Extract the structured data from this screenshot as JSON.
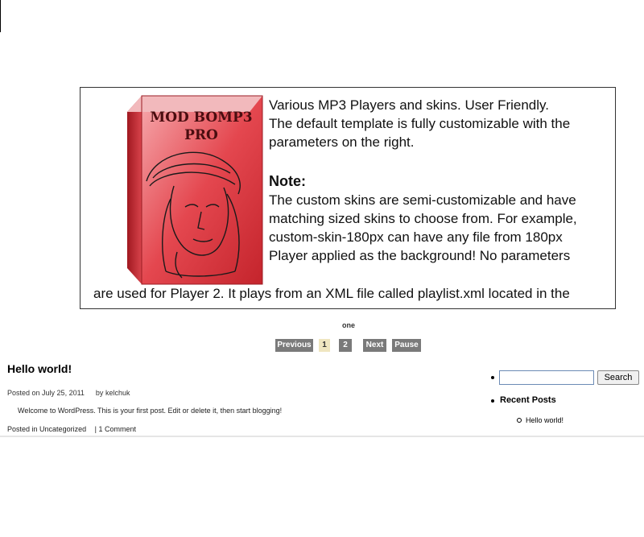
{
  "slideshow": {
    "box_title_line1": "MOD BOMP3",
    "box_title_line2": "PRO",
    "lines": [
      "Various MP3 Players and skins. User Friendly.",
      "The default template is fully customizable with the",
      "parameters on the right."
    ],
    "note_heading": "Note:",
    "note_lines": [
      "The custom skins are semi-customizable and have",
      "matching sized skins to choose from. For example,",
      "custom-skin-180px can have any file from 180px",
      "Player applied as the background! No parameters"
    ],
    "wide_line": "are used for Player 2. It plays from an XML file called playlist.xml located in the",
    "caption": "one",
    "nav": {
      "previous": "Previous",
      "page1": "1",
      "page2": "2",
      "next": "Next",
      "pause": "Pause"
    }
  },
  "post": {
    "title": "Hello world!",
    "posted_on_prefix": "Posted on",
    "date": "July 25, 2011",
    "by_prefix": "by",
    "author": "kelchuk",
    "body": "Welcome to WordPress. This is your first post. Edit or delete it, then start blogging!",
    "posted_in_prefix": "Posted in",
    "category": "Uncategorized",
    "separator": "|",
    "comments": "1 Comment"
  },
  "sidebar": {
    "search_value": "",
    "search_button": "Search",
    "recent_posts_title": "Recent Posts",
    "recent_posts": [
      "Hello world!"
    ]
  }
}
